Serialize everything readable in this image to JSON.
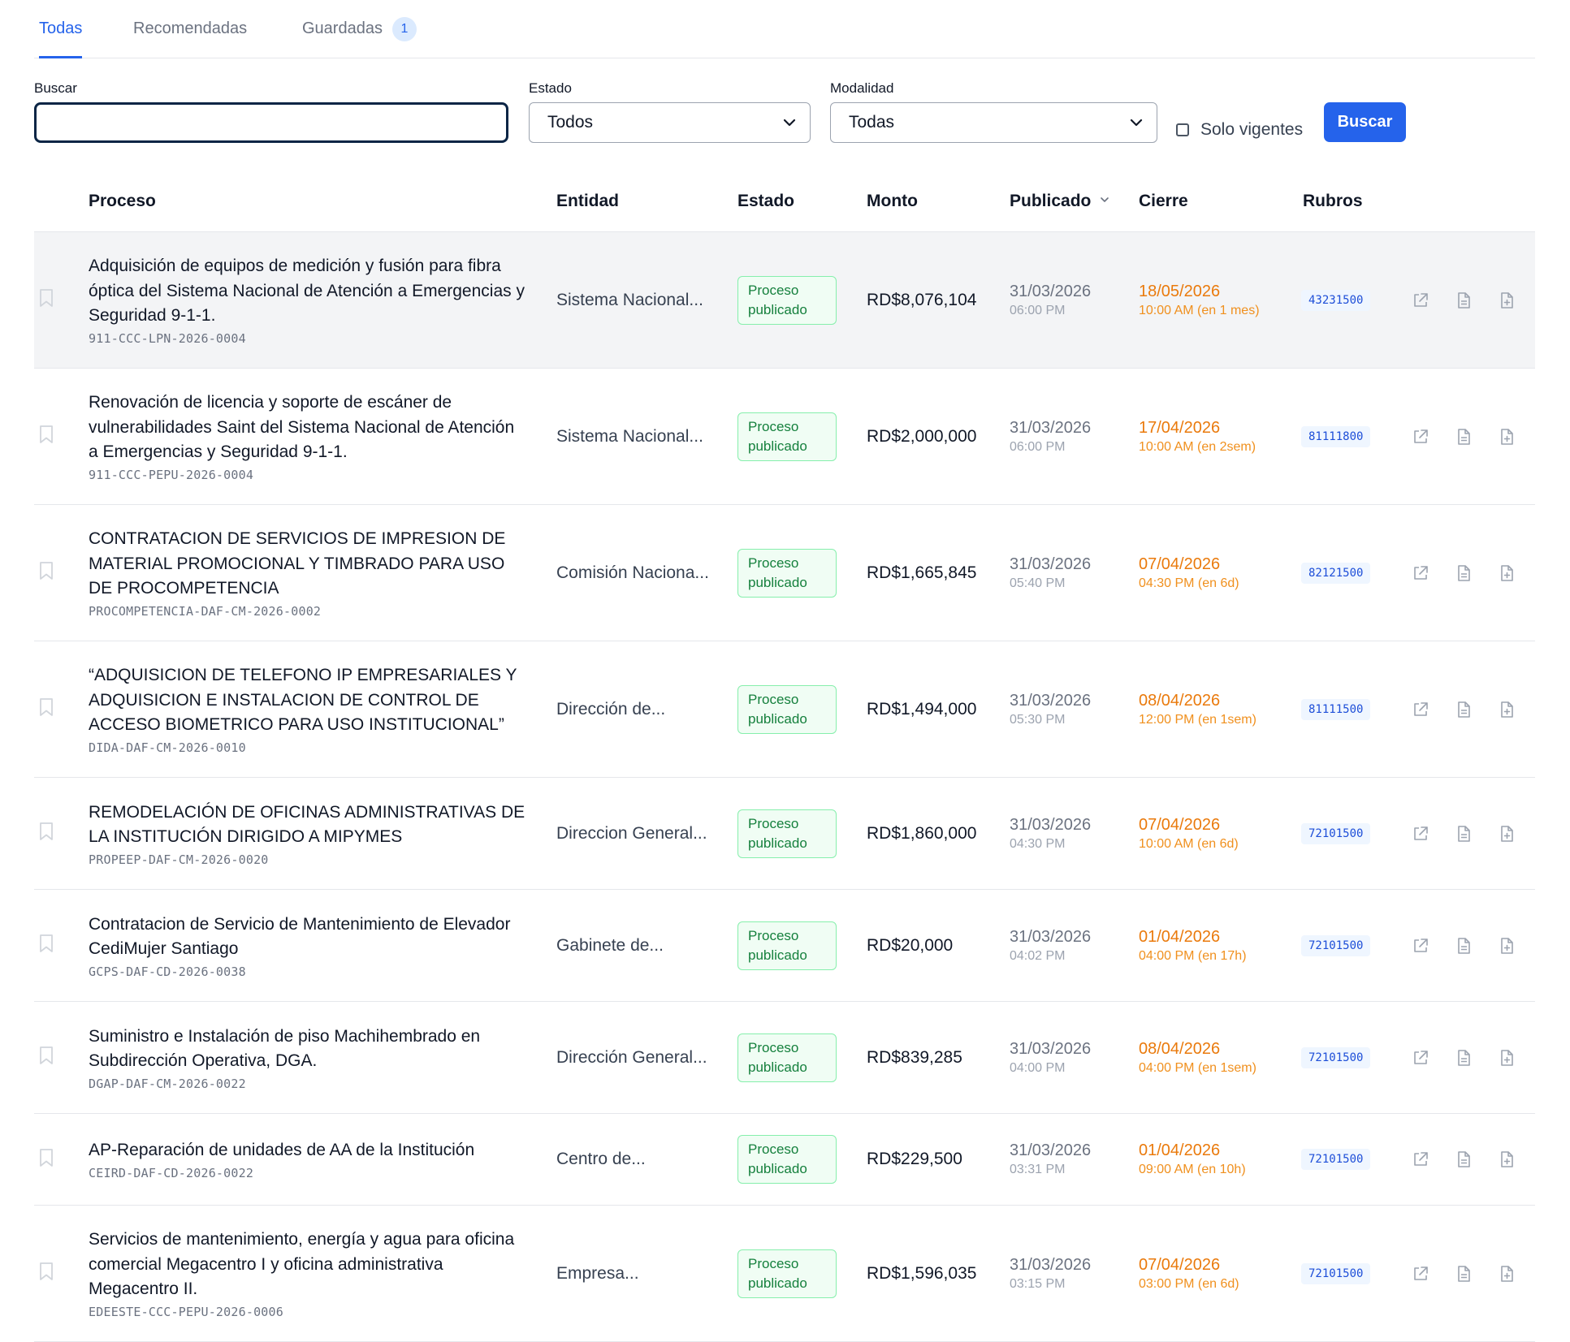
{
  "tabs": [
    {
      "label": "Todas",
      "active": true
    },
    {
      "label": "Recomendadas",
      "active": false
    },
    {
      "label": "Guardadas",
      "active": false,
      "badge": "1"
    }
  ],
  "filters": {
    "search_label": "Buscar",
    "search_value": "",
    "estado_label": "Estado",
    "estado_value": "Todos",
    "modalidad_label": "Modalidad",
    "modalidad_value": "Todas",
    "solo_vigentes_label": "Solo vigentes",
    "solo_vigentes_checked": false,
    "buscar_button": "Buscar"
  },
  "table": {
    "headers": {
      "proceso": "Proceso",
      "entidad": "Entidad",
      "estado": "Estado",
      "monto": "Monto",
      "publicado": "Publicado",
      "cierre": "Cierre",
      "rubros": "Rubros"
    },
    "sorted_by": "Publicado",
    "rows": [
      {
        "title": "Adquisición de equipos de medición y fusión para fibra óptica del Sistema Nacional de Atención a Emergencias y Seguridad 9-1-1.",
        "code": "911-CCC-LPN-2026-0004",
        "entidad": "Sistema Nacional...",
        "estado": "Proceso publicado",
        "monto": "RD$8,076,104",
        "pub_date": "31/03/2026",
        "pub_time": "06:00 PM",
        "cierre_date": "18/05/2026",
        "cierre_time": "10:00 AM (en 1 mes)",
        "rubro": "43231500"
      },
      {
        "title": "Renovación de licencia y soporte de escáner de vulnerabilidades Saint del Sistema Nacional de Atención a Emergencias y Seguridad 9-1-1.",
        "code": "911-CCC-PEPU-2026-0004",
        "entidad": "Sistema Nacional...",
        "estado": "Proceso publicado",
        "monto": "RD$2,000,000",
        "pub_date": "31/03/2026",
        "pub_time": "06:00 PM",
        "cierre_date": "17/04/2026",
        "cierre_time": "10:00 AM (en 2sem)",
        "rubro": "81111800"
      },
      {
        "title": "CONTRATACION DE SERVICIOS DE IMPRESION DE MATERIAL PROMOCIONAL Y TIMBRADO PARA USO DE PROCOMPETENCIA",
        "code": "PROCOMPETENCIA-DAF-CM-2026-0002",
        "entidad": "Comisión Naciona...",
        "estado": "Proceso publicado",
        "monto": "RD$1,665,845",
        "pub_date": "31/03/2026",
        "pub_time": "05:40 PM",
        "cierre_date": "07/04/2026",
        "cierre_time": "04:30 PM (en 6d)",
        "rubro": "82121500"
      },
      {
        "title": "“ADQUISICION DE TELEFONO IP EMPRESARIALES Y ADQUISICION E INSTALACION DE CONTROL DE ACCESO BIOMETRICO PARA USO INSTITUCIONAL”",
        "code": "DIDA-DAF-CM-2026-0010",
        "entidad": "Dirección de...",
        "estado": "Proceso publicado",
        "monto": "RD$1,494,000",
        "pub_date": "31/03/2026",
        "pub_time": "05:30 PM",
        "cierre_date": "08/04/2026",
        "cierre_time": "12:00 PM (en 1sem)",
        "rubro": "81111500"
      },
      {
        "title": "REMODELACIÓN DE OFICINAS ADMINISTRATIVAS DE LA INSTITUCIÓN DIRIGIDO A MIPYMES",
        "code": "PROPEEP-DAF-CM-2026-0020",
        "entidad": "Direccion General...",
        "estado": "Proceso publicado",
        "monto": "RD$1,860,000",
        "pub_date": "31/03/2026",
        "pub_time": "04:30 PM",
        "cierre_date": "07/04/2026",
        "cierre_time": "10:00 AM (en 6d)",
        "rubro": "72101500"
      },
      {
        "title": "Contratacion de Servicio de Mantenimiento de Elevador CediMujer Santiago",
        "code": "GCPS-DAF-CD-2026-0038",
        "entidad": "Gabinete de...",
        "estado": "Proceso publicado",
        "monto": "RD$20,000",
        "pub_date": "31/03/2026",
        "pub_time": "04:02 PM",
        "cierre_date": "01/04/2026",
        "cierre_time": "04:00 PM (en 17h)",
        "rubro": "72101500"
      },
      {
        "title": "Suministro e Instalación de piso Machihembrado en Subdirección Operativa, DGA.",
        "code": "DGAP-DAF-CM-2026-0022",
        "entidad": "Dirección General...",
        "estado": "Proceso publicado",
        "monto": "RD$839,285",
        "pub_date": "31/03/2026",
        "pub_time": "04:00 PM",
        "cierre_date": "08/04/2026",
        "cierre_time": "04:00 PM (en 1sem)",
        "rubro": "72101500"
      },
      {
        "title": "AP-Reparación de unidades de AA de la Institución",
        "code": "CEIRD-DAF-CD-2026-0022",
        "entidad": "Centro de...",
        "estado": "Proceso publicado",
        "monto": "RD$229,500",
        "pub_date": "31/03/2026",
        "pub_time": "03:31 PM",
        "cierre_date": "01/04/2026",
        "cierre_time": "09:00 AM (en 10h)",
        "rubro": "72101500"
      },
      {
        "title": "Servicios de mantenimiento, energía y agua para oficina comercial Megacentro I y oficina administrativa Megacentro II.",
        "code": "EDEESTE-CCC-PEPU-2026-0006",
        "entidad": "Empresa...",
        "estado": "Proceso publicado",
        "monto": "RD$1,596,035",
        "pub_date": "31/03/2026",
        "pub_time": "03:15 PM",
        "cierre_date": "07/04/2026",
        "cierre_time": "03:00 PM (en 6d)",
        "rubro": "72101500"
      }
    ]
  },
  "colors": {
    "accent": "#2563eb",
    "status_green": "#15803d",
    "deadline_orange": "#ea7a0c",
    "rubro_blue": "#1d4ed8"
  },
  "icons": [
    "bookmark-icon",
    "external-link-icon",
    "document-icon",
    "document-add-icon",
    "chevron-down-icon",
    "sort-arrow-icon"
  ]
}
